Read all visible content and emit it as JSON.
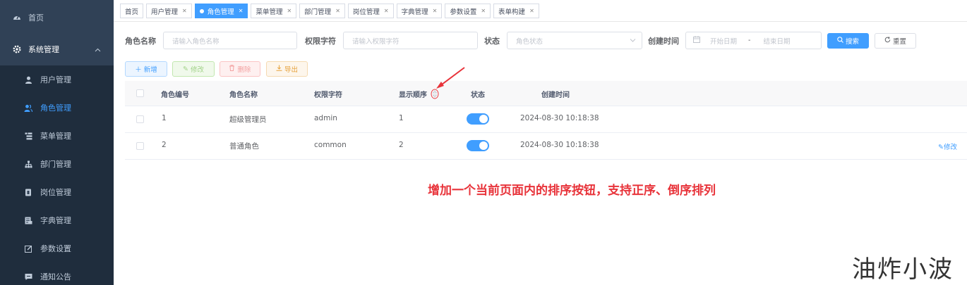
{
  "sidebar": {
    "home": {
      "label": "首页",
      "icon": "dashboard-icon"
    },
    "group": {
      "label": "系统管理",
      "icon": "gear-icon"
    },
    "items": [
      {
        "label": "用户管理",
        "icon": "user-icon"
      },
      {
        "label": "角色管理",
        "icon": "peoples-icon",
        "active": true
      },
      {
        "label": "菜单管理",
        "icon": "tree-table-icon"
      },
      {
        "label": "部门管理",
        "icon": "tree-icon"
      },
      {
        "label": "岗位管理",
        "icon": "post-icon"
      },
      {
        "label": "字典管理",
        "icon": "dict-icon"
      },
      {
        "label": "参数设置",
        "icon": "edit-icon"
      },
      {
        "label": "通知公告",
        "icon": "message-icon"
      }
    ]
  },
  "tags": [
    {
      "label": "首页"
    },
    {
      "label": "用户管理"
    },
    {
      "label": "角色管理",
      "active": true
    },
    {
      "label": "菜单管理"
    },
    {
      "label": "部门管理"
    },
    {
      "label": "岗位管理"
    },
    {
      "label": "字典管理"
    },
    {
      "label": "参数设置"
    },
    {
      "label": "表单构建"
    }
  ],
  "search": {
    "role_name_label": "角色名称",
    "role_name_placeholder": "请输入角色名称",
    "role_key_label": "权限字符",
    "role_key_placeholder": "请输入权限字符",
    "status_label": "状态",
    "status_placeholder": "角色状态",
    "created_label": "创建时间",
    "start_placeholder": "开始日期",
    "range_sep": "-",
    "end_placeholder": "结束日期",
    "search_button": "搜索",
    "reset_button": "重置"
  },
  "toolbar": {
    "add": "新增",
    "edit": "修改",
    "delete": "删除",
    "export": "导出"
  },
  "table": {
    "columns": [
      "角色编号",
      "角色名称",
      "权限字符",
      "显示顺序",
      "状态",
      "创建时间"
    ],
    "rows": [
      {
        "id": "1",
        "name": "超级管理员",
        "key": "admin",
        "sort": "1",
        "status": true,
        "created": "2024-08-30 10:18:38",
        "action": ""
      },
      {
        "id": "2",
        "name": "普通角色",
        "key": "common",
        "sort": "2",
        "status": true,
        "created": "2024-08-30 10:18:38",
        "action": "修改"
      }
    ]
  },
  "annotation": "增加一个当前页面内的排序按钮，支持正序、倒序排列",
  "watermark": "油炸小波",
  "colors": {
    "sidebar": "#304156",
    "primary": "#409eff",
    "annotation": "#e8333a"
  }
}
